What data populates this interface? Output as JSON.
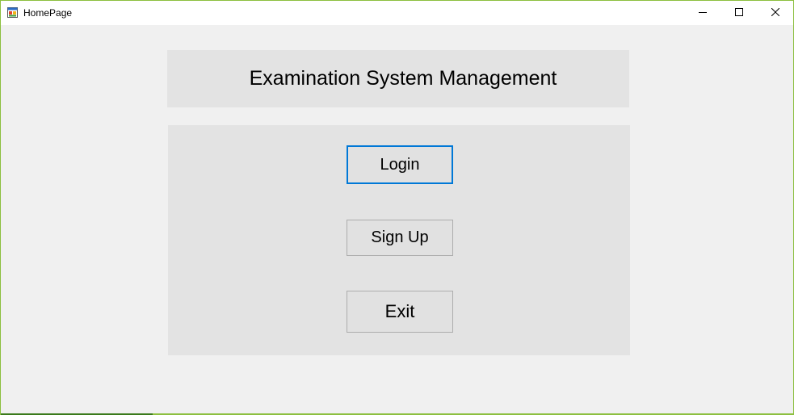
{
  "window": {
    "title": "HomePage",
    "icon": "winforms-app-icon",
    "controls": {
      "minimize_icon": "minimize-icon",
      "maximize_icon": "maximize-icon",
      "close_icon": "close-icon"
    }
  },
  "header": {
    "title": "Examination System Management"
  },
  "buttons": {
    "login": "Login",
    "signup": "Sign Up",
    "exit": "Exit"
  },
  "colors": {
    "focus_border": "#0078d7",
    "window_border": "#8cbf3f",
    "panel_bg": "#e3e3e3",
    "form_bg": "#f0f0f0"
  }
}
